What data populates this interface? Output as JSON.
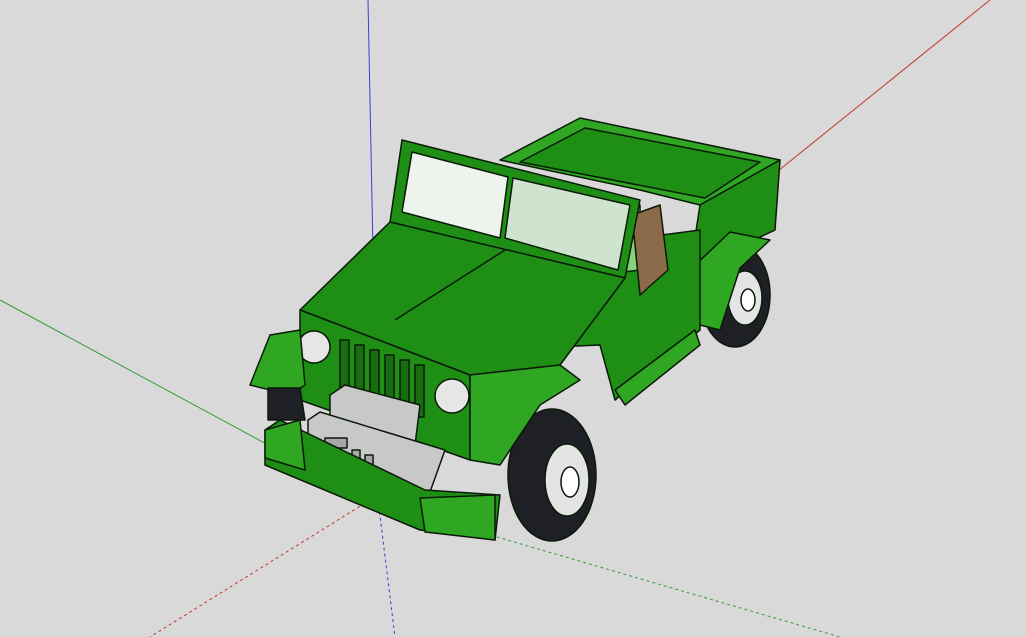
{
  "colors": {
    "background": "#d9d9d9",
    "body_green": "#1e8f14",
    "body_green_light": "#2fa722",
    "body_green_dark": "#166e0f",
    "edge": "#0a1a08",
    "glass": "#eef3ee",
    "interior_green": "#86d37a",
    "seat_tan": "#c8b8a0",
    "seat_brown": "#8a6a48",
    "grille_gray": "#c8c8c8",
    "headlight": "#e6e6e6",
    "tire": "#1f1f26",
    "rim": "#e4e4e4",
    "axis_red": "#c0392b",
    "axis_green": "#3a9a3a",
    "axis_blue": "#3344cc"
  },
  "icons": [
    "red-axis",
    "green-axis",
    "blue-axis",
    "jeep-model"
  ]
}
